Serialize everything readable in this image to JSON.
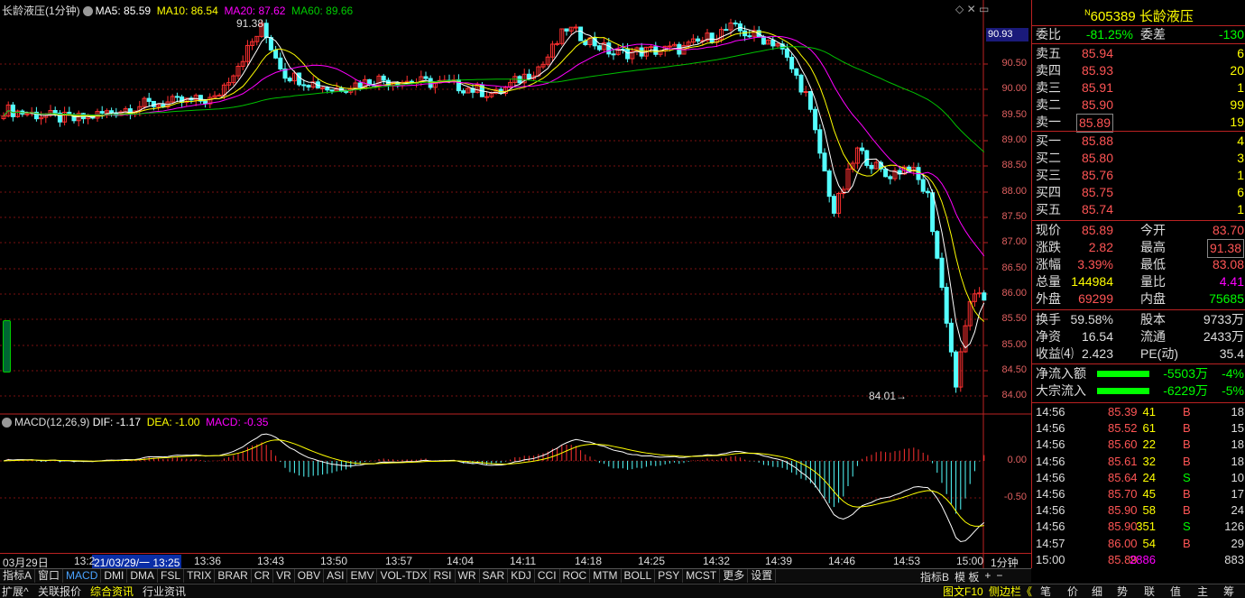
{
  "title": "长龄液压(1分钟)",
  "ma": {
    "ma5": "MA5: 85.59",
    "ma10": "MA10: 86.54",
    "ma20": "MA20: 87.62",
    "ma60": "MA60: 89.66"
  },
  "colors": {
    "ma5": "#ffffff",
    "ma10": "#ffff00",
    "ma20": "#ff00ff",
    "ma60": "#00c000",
    "up": "#ff3030",
    "down": "#54ffff",
    "grid": "#7a1010"
  },
  "price_axis": {
    "current": "90.93",
    "ticks": [
      "90.50",
      "90.00",
      "89.50",
      "89.00",
      "88.50",
      "88.00",
      "87.50",
      "87.00",
      "86.50",
      "86.00",
      "85.50",
      "85.00",
      "84.50",
      "84.00"
    ]
  },
  "macd": {
    "label": "MACD(12,26,9)",
    "dif": "DIF: -1.17",
    "dea": "DEA: -1.00",
    "macd": "MACD: -0.35",
    "ticks": [
      "0.00",
      "-0.50"
    ]
  },
  "annotations": {
    "high": "91.38",
    "low": "84.01"
  },
  "time_axis": {
    "date": "03月29日",
    "cursor": "21/03/29/一 13:25",
    "ticks": [
      "13:2",
      "13:36",
      "13:43",
      "13:50",
      "13:57",
      "14:04",
      "14:11",
      "14:18",
      "14:25",
      "14:32",
      "14:39",
      "14:46",
      "14:53",
      "15:00"
    ],
    "period": "1分钟"
  },
  "chart_data": [
    {
      "type": "candlestick",
      "title": "长龄液压(1分钟)",
      "period": "1分钟",
      "y_range": [
        84.0,
        90.93
      ],
      "annotations": {
        "high": 91.38,
        "low": 84.01
      },
      "last_ma": {
        "MA5": 85.59,
        "MA10": 86.54,
        "MA20": 87.62,
        "MA60": 89.66
      }
    },
    {
      "type": "bar",
      "title": "MACD(12,26,9)",
      "series": [
        {
          "name": "DIF",
          "last": -1.17
        },
        {
          "name": "DEA",
          "last": -1.0
        },
        {
          "name": "MACD",
          "last": -0.35
        }
      ]
    }
  ],
  "toolbar": [
    "指标A",
    "窗口",
    "MACD",
    "DMI",
    "DMA",
    "FSL",
    "TRIX",
    "BRAR",
    "CR",
    "VR",
    "OBV",
    "ASI",
    "EMV",
    "VOL-TDX",
    "RSI",
    "WR",
    "SAR",
    "KDJ",
    "CCI",
    "ROC",
    "MTM",
    "BOLL",
    "PSY",
    "MCST",
    "更多",
    "设置"
  ],
  "toolbar_right": [
    "指标B",
    "模 板",
    "+",
    "−"
  ],
  "bottom_left": [
    "扩展^",
    "关联报价",
    "综合资讯",
    "行业资讯"
  ],
  "bottom_right": [
    "图文F10",
    "侧边栏《",
    "笔",
    "价",
    "细",
    "势",
    "联",
    "值",
    "主",
    "筹"
  ],
  "quote": {
    "code": "605389",
    "name": "长龄液压",
    "weibi_label": "委比",
    "weibi": "-81.25%",
    "weicha_label": "委差",
    "weicha": "-130",
    "sells": [
      {
        "label": "卖五",
        "price": "85.94",
        "vol": "6"
      },
      {
        "label": "卖四",
        "price": "85.93",
        "vol": "20"
      },
      {
        "label": "卖三",
        "price": "85.91",
        "vol": "1"
      },
      {
        "label": "卖二",
        "price": "85.90",
        "vol": "99"
      },
      {
        "label": "卖一",
        "price": "85.89",
        "vol": "19"
      }
    ],
    "buys": [
      {
        "label": "买一",
        "price": "85.88",
        "vol": "4"
      },
      {
        "label": "买二",
        "price": "85.80",
        "vol": "3"
      },
      {
        "label": "买三",
        "price": "85.76",
        "vol": "1"
      },
      {
        "label": "买四",
        "price": "85.75",
        "vol": "6"
      },
      {
        "label": "买五",
        "price": "85.74",
        "vol": "1"
      }
    ],
    "stats": [
      {
        "l": "现价",
        "v": "85.89",
        "l2": "今开",
        "v2": "83.70"
      },
      {
        "l": "涨跌",
        "v": "2.82",
        "l2": "最高",
        "v2": "91.38"
      },
      {
        "l": "涨幅",
        "v": "3.39%",
        "l2": "最低",
        "v2": "83.08"
      },
      {
        "l": "总量",
        "v": "144984",
        "l2": "量比",
        "v2": "4.41"
      },
      {
        "l": "外盘",
        "v": "69299",
        "l2": "内盘",
        "v2": "75685"
      }
    ],
    "stats2": [
      {
        "l": "换手",
        "v": "59.58%",
        "l2": "股本",
        "v2": "9733万"
      },
      {
        "l": "净资",
        "v": "16.54",
        "l2": "流通",
        "v2": "2433万"
      },
      {
        "l": "收益⑷",
        "v": "2.423",
        "l2": "PE(动)",
        "v2": "35.4"
      }
    ],
    "flows": [
      {
        "label": "净流入额",
        "value": "-5503万",
        "pct": "-4%"
      },
      {
        "label": "大宗流入",
        "value": "-6229万",
        "pct": "-5%"
      }
    ],
    "ticks": [
      {
        "t": "14:56",
        "p": "85.39",
        "v": "41",
        "bs": "B",
        "n": "18"
      },
      {
        "t": "14:56",
        "p": "85.52",
        "v": "61",
        "bs": "B",
        "n": "15"
      },
      {
        "t": "14:56",
        "p": "85.60",
        "v": "22",
        "bs": "B",
        "n": "18"
      },
      {
        "t": "14:56",
        "p": "85.61",
        "v": "32",
        "bs": "B",
        "n": "18"
      },
      {
        "t": "14:56",
        "p": "85.64",
        "v": "24",
        "bs": "S",
        "n": "10"
      },
      {
        "t": "14:56",
        "p": "85.70",
        "v": "45",
        "bs": "B",
        "n": "17"
      },
      {
        "t": "14:56",
        "p": "85.90",
        "v": "58",
        "bs": "B",
        "n": "24"
      },
      {
        "t": "14:56",
        "p": "85.90",
        "v": "351",
        "bs": "S",
        "n": "126"
      },
      {
        "t": "14:57",
        "p": "86.00",
        "v": "54",
        "bs": "B",
        "n": "29"
      },
      {
        "t": "15:00",
        "p": "85.89",
        "v": "2886",
        "bs": "",
        "n": "883"
      }
    ]
  }
}
